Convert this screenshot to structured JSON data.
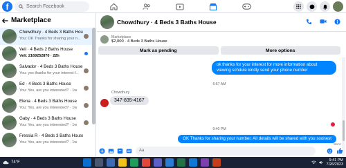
{
  "search": {
    "placeholder": "Search Facebook"
  },
  "colors": {
    "accent": "#1877f2",
    "bubble_out": "#0084ff",
    "taskbar": "#1a2236"
  },
  "sidebar": {
    "title": "Marketplace",
    "items": [
      {
        "title": "Chowdhury · 4 Beds 3 Baths House",
        "subtitle": "You: OK Thanks for sharing your n...",
        "state": "active"
      },
      {
        "title": "Veli · 4 Beds 2 Baths House",
        "subtitle": "Veli: 2169252870 · 22h",
        "state": "unread"
      },
      {
        "title": "Salvador · 4 Beds 3 Baths House",
        "subtitle": "You: yes thanks for your interest f...",
        "state": "read"
      },
      {
        "title": "Ed · 4 Beds 3 Baths House",
        "subtitle": "You: Yes, are you interested? · 1w",
        "state": "read"
      },
      {
        "title": "Elena · 4 Beds 3 Baths House",
        "subtitle": "You: Yes, are you interested? · 1w",
        "state": "read"
      },
      {
        "title": "Gaby · 4 Beds 3 Baths House",
        "subtitle": "You: Yes, are you interested? · 1w",
        "state": "read"
      },
      {
        "title": "Fressia R · 4 Beds 3 Baths House",
        "subtitle": "You: Yes, are you interested? · 1w",
        "state": "read"
      }
    ]
  },
  "chat": {
    "title": "Chowdhury · 4 Beds 3 Baths House",
    "listing_label": "Marketplace",
    "listing_price": "$2,000 · 4 Beds 3 Baths House",
    "mark_pending": "Mark as pending",
    "more_options": "More options",
    "messages": {
      "out1": "ok thanks for your interest for more information about viewing schdule kindly send your phone number",
      "time1": "6:57 AM",
      "sender": "Chowdhury",
      "in1": "347-835-4167",
      "time2": "9:40 PM",
      "out2": "OK Thanks for sharing your number. All details will be shared with you soonest",
      "status": "Sent"
    },
    "composer_placeholder": "Aa"
  },
  "taskbar": {
    "weather": "74°F",
    "time": "9:41 PM",
    "date": "7/26/2023"
  }
}
